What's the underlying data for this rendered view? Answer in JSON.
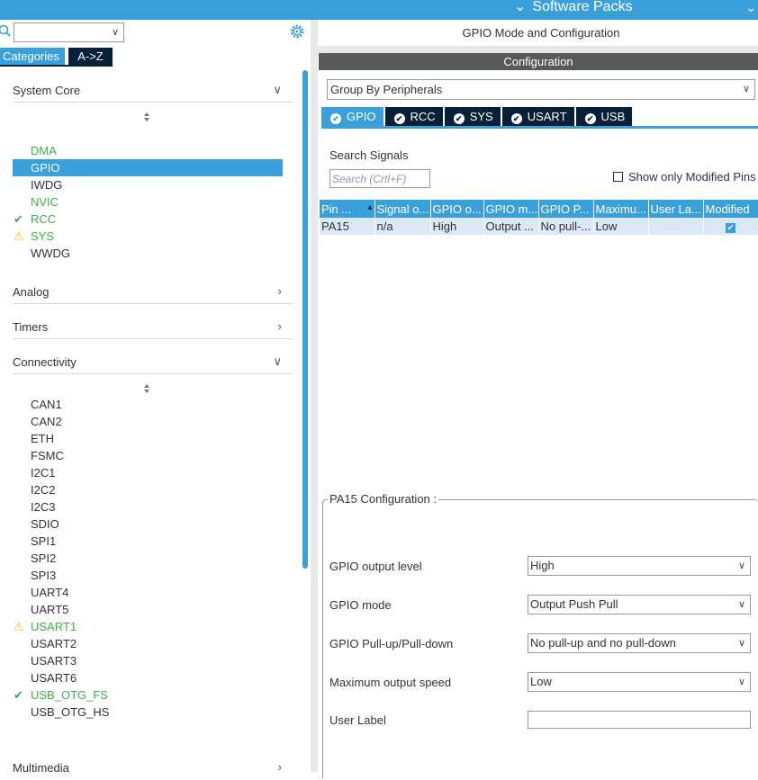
{
  "header": {
    "software_packs": "Software Packs"
  },
  "left": {
    "tabs": {
      "categories": "Categories",
      "az": "A->Z"
    },
    "categories": [
      {
        "label": "System Core",
        "expanded": true
      },
      {
        "label": "Analog",
        "expanded": false
      },
      {
        "label": "Timers",
        "expanded": false
      },
      {
        "label": "Connectivity",
        "expanded": true
      },
      {
        "label": "Multimedia",
        "expanded": false
      }
    ],
    "system_core_items": [
      {
        "label": "DMA",
        "status": "green"
      },
      {
        "label": "GPIO",
        "status": "selected"
      },
      {
        "label": "IWDG",
        "status": "none"
      },
      {
        "label": "NVIC",
        "status": "green"
      },
      {
        "label": "RCC",
        "status": "ok"
      },
      {
        "label": "SYS",
        "status": "warn"
      },
      {
        "label": "WWDG",
        "status": "none"
      }
    ],
    "connectivity_items": [
      {
        "label": "CAN1",
        "status": "none"
      },
      {
        "label": "CAN2",
        "status": "none"
      },
      {
        "label": "ETH",
        "status": "none"
      },
      {
        "label": "FSMC",
        "status": "none"
      },
      {
        "label": "I2C1",
        "status": "none"
      },
      {
        "label": "I2C2",
        "status": "none"
      },
      {
        "label": "I2C3",
        "status": "none"
      },
      {
        "label": "SDIO",
        "status": "none"
      },
      {
        "label": "SPI1",
        "status": "none"
      },
      {
        "label": "SPI2",
        "status": "none"
      },
      {
        "label": "SPI3",
        "status": "none"
      },
      {
        "label": "UART4",
        "status": "none"
      },
      {
        "label": "UART5",
        "status": "none"
      },
      {
        "label": "USART1",
        "status": "warn"
      },
      {
        "label": "USART2",
        "status": "none"
      },
      {
        "label": "USART3",
        "status": "none"
      },
      {
        "label": "USART6",
        "status": "none"
      },
      {
        "label": "USB_OTG_FS",
        "status": "ok"
      },
      {
        "label": "USB_OTG_HS",
        "status": "none"
      }
    ]
  },
  "right": {
    "title": "GPIO Mode and Configuration",
    "config_bar": "Configuration",
    "group_by": "Group By Peripherals",
    "peripheral_tabs": [
      "GPIO",
      "RCC",
      "SYS",
      "USART",
      "USB"
    ],
    "active_tab": "GPIO",
    "search_label": "Search Signals",
    "search_placeholder": "Search (Crtl+F)",
    "only_modified": "Show only Modified Pins",
    "table": {
      "headers": [
        "Pin ...",
        "Signal o...",
        "GPIO o...",
        "GPIO m...",
        "GPIO P...",
        "Maximu...",
        "User La...",
        "Modified"
      ],
      "rows": [
        [
          "PA15",
          "n/a",
          "High",
          "Output ...",
          "No pull-...",
          "Low",
          "",
          "checked"
        ]
      ]
    },
    "pin_config": {
      "legend": "PA15 Configuration :",
      "fields": [
        {
          "label": "GPIO output level",
          "value": "High"
        },
        {
          "label": "GPIO mode",
          "value": "Output Push Pull"
        },
        {
          "label": "GPIO Pull-up/Pull-down",
          "value": "No pull-up and no pull-down"
        },
        {
          "label": "Maximum output speed",
          "value": "Low"
        }
      ],
      "user_label": "User Label"
    }
  },
  "colors": {
    "accent": "#3aa0db",
    "dark": "#07203a",
    "green": "#39b24a",
    "warn": "#f0c400"
  }
}
